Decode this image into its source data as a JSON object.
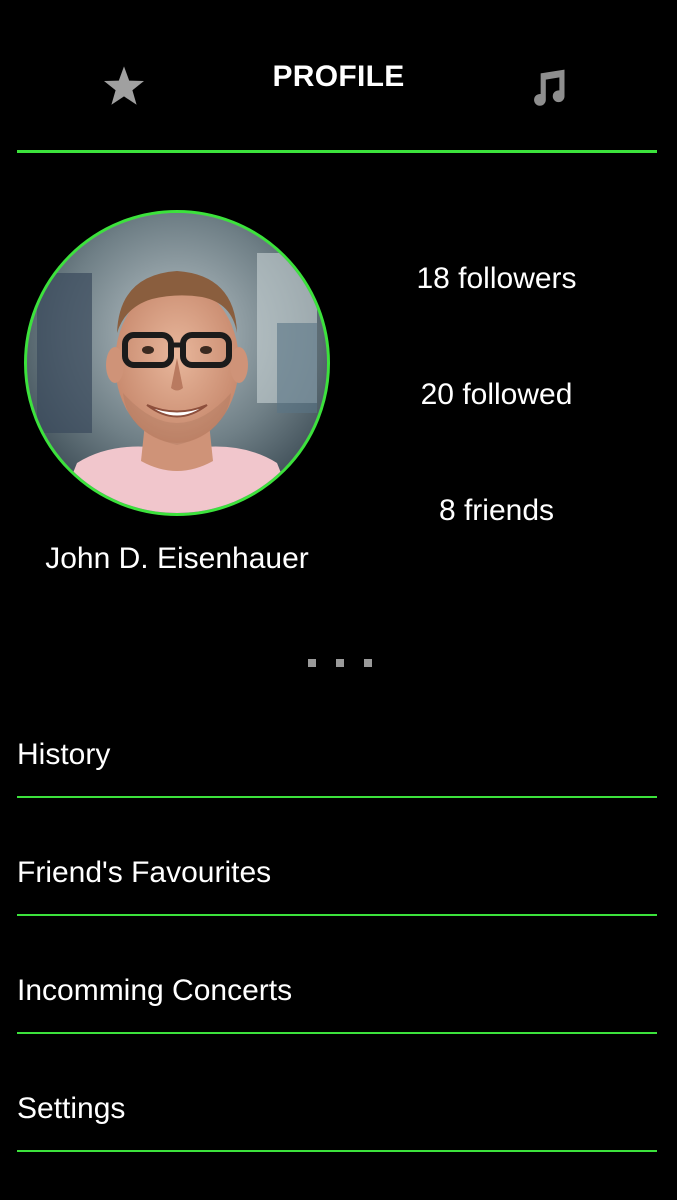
{
  "header": {
    "title": "PROFILE",
    "left_icon": "star-icon",
    "right_icon": "music-note-icon"
  },
  "profile": {
    "name": "John D. Eisenhauer",
    "avatar": "profile-photo",
    "stats": {
      "followers": "18 followers",
      "followed": "20 followed",
      "friends": "8 friends"
    }
  },
  "more_icon": "ellipsis-icon",
  "menu": {
    "items": [
      {
        "label": "History"
      },
      {
        "label": "Friend's Favourites"
      },
      {
        "label": "Incomming Concerts"
      },
      {
        "label": "Settings"
      }
    ]
  },
  "colors": {
    "accent": "#3ce23c",
    "background": "#000000",
    "icon_gray": "#9a9a9a",
    "text": "#ffffff"
  }
}
